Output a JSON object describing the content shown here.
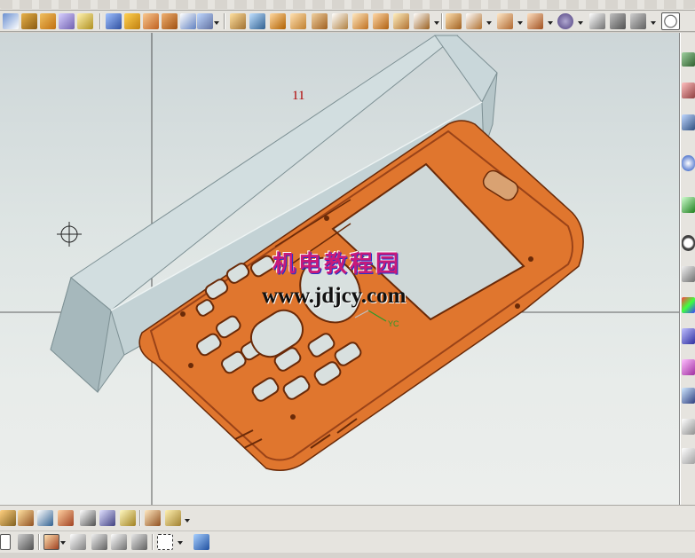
{
  "viewport": {
    "view_label": "11",
    "watermark_cn": "机电教程园",
    "watermark_url": "www.jdjcy.com",
    "csys_axis_label": "YC"
  },
  "colors": {
    "part": "#e0762e",
    "part_dark": "#9a4318",
    "block": "#b6c6c9",
    "block_dark": "#8ea3a7",
    "block_light": "#d2dee0"
  },
  "icons": {
    "top_toolbar": [
      "sketch-icon",
      "box-icon",
      "extrude-icon",
      "cylinder-icon",
      "hole-icon",
      "sync-icon",
      "blend-icon",
      "chamfer-icon",
      "shell-icon",
      "draft-icon",
      "trim-icon",
      "unite-icon",
      "subtract-icon",
      "intersect-icon",
      "mirror-icon",
      "pattern-icon",
      "offset-icon",
      "thicken-icon",
      "sew-icon",
      "patch-icon",
      "surface-icon",
      "measure-icon",
      "analysis-icon",
      "section-icon",
      "shade-icon",
      "wireframe-icon",
      "render-icon",
      "clock-icon"
    ],
    "right_bar": [
      "assembly-icon",
      "layer-icon",
      "info-icon",
      "part-nav-icon",
      "history-icon",
      "palette-icon",
      "roles-icon",
      "web-icon",
      "system-icon"
    ],
    "bottom_toolbar_1": [
      "snap-icon",
      "point-icon",
      "end-point-icon",
      "mid-point-icon",
      "control-point-icon",
      "intersection-icon",
      "center-icon",
      "dimension-icon",
      "note-icon"
    ],
    "bottom_toolbar_2": [
      "selection-filter-icon",
      "assembly-filter-icon",
      "component-icon",
      "undo-icon",
      "wcs-icon",
      "move-icon",
      "tool-icon",
      "window-select-icon",
      "cube-icon"
    ]
  }
}
